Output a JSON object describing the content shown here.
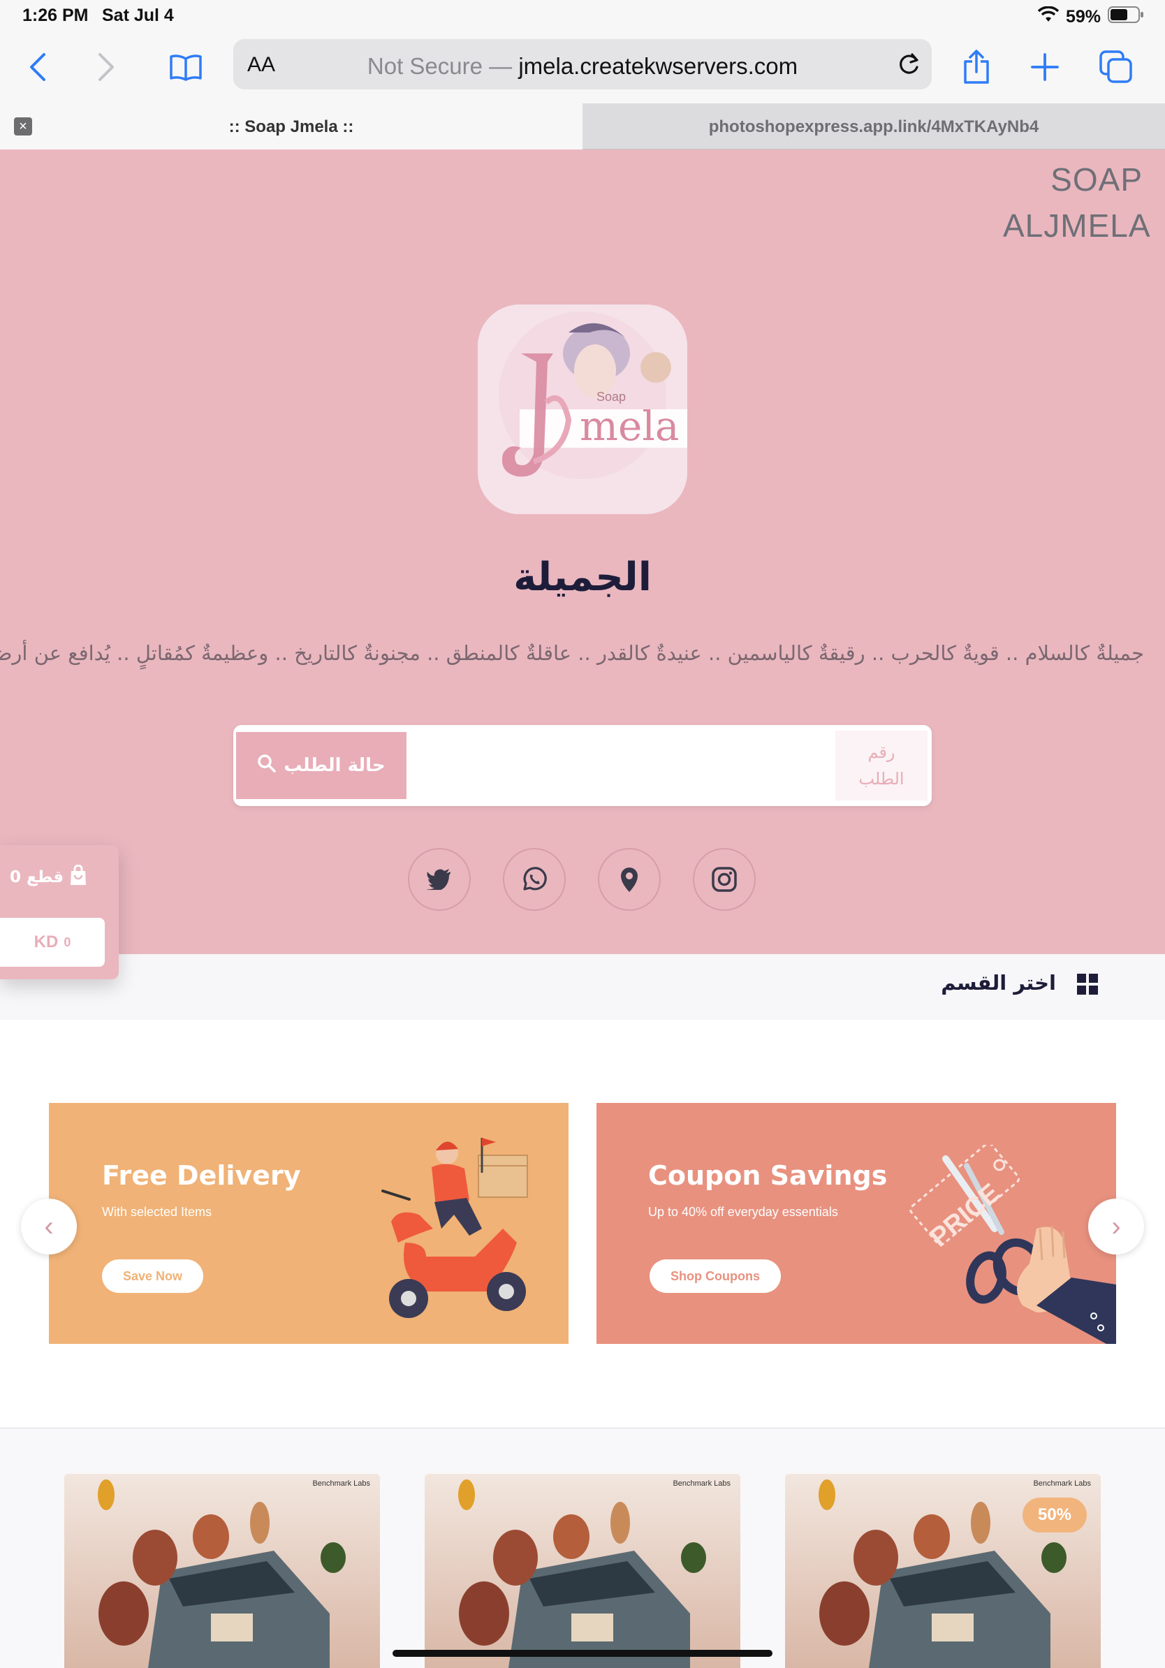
{
  "status_bar": {
    "time": "1:26 PM",
    "date": "Sat Jul 4",
    "battery": "59%"
  },
  "browser": {
    "aa_label": "AA",
    "url_prefix": "Not Secure —",
    "url_domain": "jmela.createkwservers.com",
    "tabs": [
      {
        "title": ":: Soap Jmela ::",
        "active": true
      },
      {
        "title": "photoshopexpress.app.link/4MxTKAyNb4",
        "active": false
      }
    ]
  },
  "site": {
    "brand": "SOAP ALJMELA",
    "logo_text": "mela",
    "logo_sub": "Soap",
    "store_name": "الجميلة",
    "tagline": "جميلةٌ كالسلام .. قويةٌ كالحرب .. رقيقةٌ كالياسمين .. عنيدةٌ كالقدر .. عاقلةٌ كالمنطق .. مجنونةٌ كالتاريخ .. وعظيمةٌ كمُقاتلٍ .. يُدافع عن أرضه",
    "search": {
      "button_label": "حالة الطلب",
      "order_label": "رقم الطلب",
      "value": ""
    },
    "social": [
      "twitter-icon",
      "whatsapp-icon",
      "location-icon",
      "instagram-icon"
    ],
    "cart": {
      "count": "0",
      "count_label": "قطع",
      "currency": "KD",
      "total": "0"
    },
    "category_label": "اختر القسم",
    "promos": [
      {
        "title": "Free Delivery",
        "subtitle": "With selected Items",
        "button": "Save Now",
        "color": "#f0b276",
        "text_accent": "#f0b276"
      },
      {
        "title": "Coupon Savings",
        "subtitle": "Up to 40% off everyday essentials",
        "button": "Shop Coupons",
        "color": "#e8917f",
        "text_accent": "#e8917f"
      }
    ],
    "products": [
      {
        "brand": "Benchmark Labs",
        "badge": ""
      },
      {
        "brand": "Benchmark Labs",
        "badge": ""
      },
      {
        "brand": "Benchmark Labs",
        "badge": "50%"
      }
    ]
  },
  "colors": {
    "hero_bg": "#eab7bf",
    "accent": "#e8adb7",
    "heading": "#1d1d3a",
    "ios_blue": "#2f7cf6"
  }
}
